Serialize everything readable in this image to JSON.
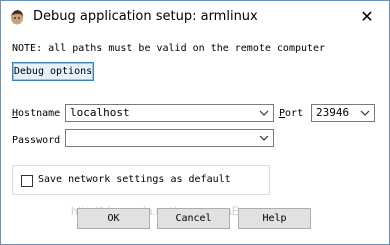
{
  "window": {
    "title": "Debug application setup: armlinux",
    "close_glyph": "✕"
  },
  "note": "NOTE: all paths must be valid on the remote computer",
  "debug_options_label": "Debug options",
  "fields": {
    "hostname": {
      "label_underlined": "H",
      "label_rest": "ostname",
      "value": "localhost"
    },
    "port": {
      "label_underlined": "P",
      "label_rest": "ort",
      "value": "23946"
    },
    "password": {
      "label_underlined": "",
      "label_rest": "Password",
      "value": ""
    }
  },
  "save_settings": {
    "label": "Save network settings as default",
    "checked": false
  },
  "buttons": {
    "ok": "OK",
    "cancel": "Cancel",
    "help": "Help"
  },
  "watermark": "http://blog.csdn.net/supernovaExp"
}
